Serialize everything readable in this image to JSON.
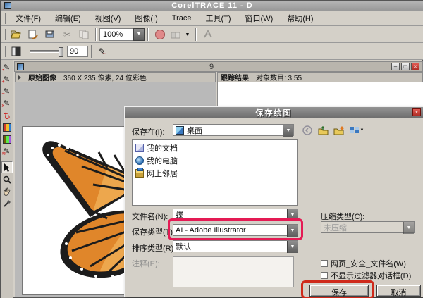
{
  "window": {
    "title": "CorelTRACE 11 - D",
    "controls": {
      "minimize": "–",
      "restore": "□",
      "close": "×"
    }
  },
  "menu": {
    "items": [
      {
        "label": "文件(F)"
      },
      {
        "label": "编辑(E)"
      },
      {
        "label": "视图(V)"
      },
      {
        "label": "图像(I)"
      },
      {
        "label": "Trace"
      },
      {
        "label": "工具(T)"
      },
      {
        "label": "窗口(W)"
      },
      {
        "label": "帮助(H)"
      }
    ]
  },
  "toolbar": {
    "zoom_value": "100%",
    "tolerance_value": "90",
    "cut_glyph": "✂",
    "dropdown_glyph": "▼"
  },
  "child_window": {
    "title_fragment": "9"
  },
  "panes": {
    "original": {
      "title": "原始图像",
      "info": "360 X 235 像素, 24 位彩色"
    },
    "result": {
      "title": "跟踪结果",
      "info": "对象数目:  3.55"
    }
  },
  "dialog": {
    "title": "保存绘图",
    "save_in_label": "保存在(I):",
    "save_in_value": "桌面",
    "places": [
      {
        "label": "我的文档"
      },
      {
        "label": "我的电脑"
      },
      {
        "label": "网上邻居"
      }
    ],
    "file_name_label": "文件名(N):",
    "file_name_value": "蝶",
    "save_type_label": "保存类型(T):",
    "save_type_value": "AI - Adobe Illustrator",
    "compress_label": "压缩类型(C):",
    "compress_value": "未压缩",
    "sort_type_label": "排序类型(R):",
    "sort_type_value": "默认",
    "notes_label": "注释(E):",
    "checkbox_web_label": "网页_安全_文件名(W)",
    "checkbox_filter_label": "不显示过滤器对话框(D)",
    "save_button": "保存",
    "cancel_button": "取消"
  },
  "annotations": {
    "save_type_box_color": "#e41a54",
    "save_button_box_color": "#cf2a1b"
  }
}
